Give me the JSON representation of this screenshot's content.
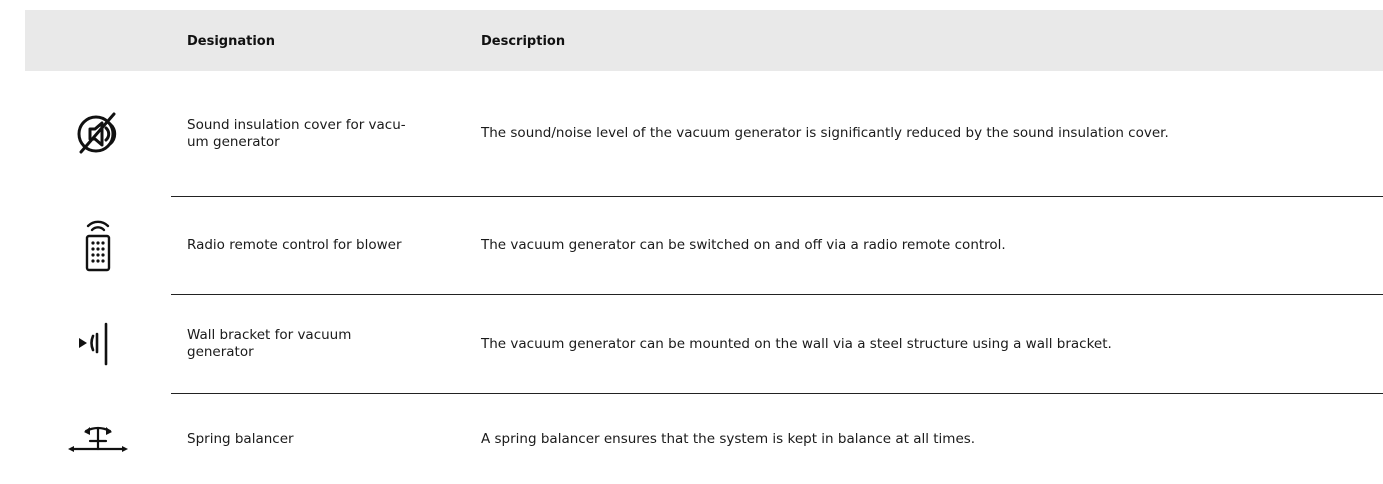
{
  "table": {
    "headers": {
      "icon": "",
      "designation": "Designation",
      "description": "Description"
    },
    "rows": [
      {
        "icon": "sound-insulation-icon",
        "designation": "Sound insulation cover for vacu-\num generator",
        "description": "The sound/noise level of the vacuum generator is significantly reduced by the sound insulation cover."
      },
      {
        "icon": "radio-remote-control-icon",
        "designation": "Radio remote control for blower",
        "description": "The vacuum generator can be switched on and off via a radio remote control."
      },
      {
        "icon": "wall-bracket-icon",
        "designation": "Wall bracket for vacuum\ngenerator",
        "description": "The vacuum generator can be mounted on the wall via a steel structure using a wall bracket."
      },
      {
        "icon": "spring-balancer-icon",
        "designation": "Spring balancer",
        "description": "A spring balancer ensures that the system is kept in balance at all times."
      }
    ]
  }
}
